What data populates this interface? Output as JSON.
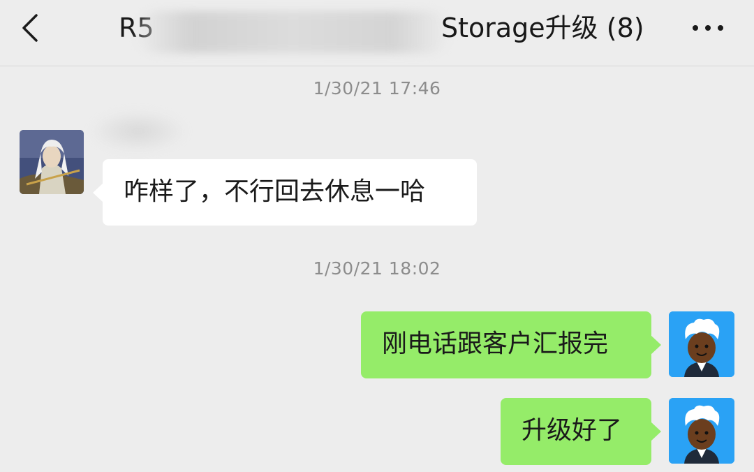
{
  "header": {
    "title_prefix": "R5",
    "title_suffix": "Storage升级 (8)",
    "back_icon": "chevron-left-icon",
    "more_icon": "more-dots-icon"
  },
  "messages": [
    {
      "type": "timestamp",
      "text": "1/30/21 17:46"
    },
    {
      "type": "incoming",
      "text": "咋样了，不行回去休息一哈"
    },
    {
      "type": "timestamp",
      "text": "1/30/21 18:02"
    },
    {
      "type": "outgoing",
      "text": "刚电话跟客户汇报完"
    },
    {
      "type": "outgoing",
      "text": "升级好了"
    }
  ],
  "colors": {
    "background": "#ededed",
    "incoming_bubble": "#ffffff",
    "outgoing_bubble": "#95ec69",
    "timestamp": "#8c8c8c",
    "avatar_right_bg": "#2aa2f5"
  }
}
